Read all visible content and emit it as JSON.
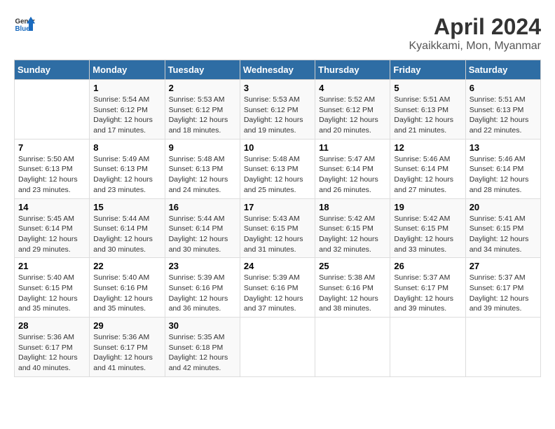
{
  "header": {
    "logo_line1": "General",
    "logo_line2": "Blue",
    "title": "April 2024",
    "subtitle": "Kyaikkami, Mon, Myanmar"
  },
  "days_of_week": [
    "Sunday",
    "Monday",
    "Tuesday",
    "Wednesday",
    "Thursday",
    "Friday",
    "Saturday"
  ],
  "weeks": [
    [
      {
        "day": "",
        "sunrise": "",
        "sunset": "",
        "daylight": ""
      },
      {
        "day": "1",
        "sunrise": "Sunrise: 5:54 AM",
        "sunset": "Sunset: 6:12 PM",
        "daylight": "Daylight: 12 hours and 17 minutes."
      },
      {
        "day": "2",
        "sunrise": "Sunrise: 5:53 AM",
        "sunset": "Sunset: 6:12 PM",
        "daylight": "Daylight: 12 hours and 18 minutes."
      },
      {
        "day": "3",
        "sunrise": "Sunrise: 5:53 AM",
        "sunset": "Sunset: 6:12 PM",
        "daylight": "Daylight: 12 hours and 19 minutes."
      },
      {
        "day": "4",
        "sunrise": "Sunrise: 5:52 AM",
        "sunset": "Sunset: 6:12 PM",
        "daylight": "Daylight: 12 hours and 20 minutes."
      },
      {
        "day": "5",
        "sunrise": "Sunrise: 5:51 AM",
        "sunset": "Sunset: 6:13 PM",
        "daylight": "Daylight: 12 hours and 21 minutes."
      },
      {
        "day": "6",
        "sunrise": "Sunrise: 5:51 AM",
        "sunset": "Sunset: 6:13 PM",
        "daylight": "Daylight: 12 hours and 22 minutes."
      }
    ],
    [
      {
        "day": "7",
        "sunrise": "Sunrise: 5:50 AM",
        "sunset": "Sunset: 6:13 PM",
        "daylight": "Daylight: 12 hours and 23 minutes."
      },
      {
        "day": "8",
        "sunrise": "Sunrise: 5:49 AM",
        "sunset": "Sunset: 6:13 PM",
        "daylight": "Daylight: 12 hours and 23 minutes."
      },
      {
        "day": "9",
        "sunrise": "Sunrise: 5:48 AM",
        "sunset": "Sunset: 6:13 PM",
        "daylight": "Daylight: 12 hours and 24 minutes."
      },
      {
        "day": "10",
        "sunrise": "Sunrise: 5:48 AM",
        "sunset": "Sunset: 6:13 PM",
        "daylight": "Daylight: 12 hours and 25 minutes."
      },
      {
        "day": "11",
        "sunrise": "Sunrise: 5:47 AM",
        "sunset": "Sunset: 6:14 PM",
        "daylight": "Daylight: 12 hours and 26 minutes."
      },
      {
        "day": "12",
        "sunrise": "Sunrise: 5:46 AM",
        "sunset": "Sunset: 6:14 PM",
        "daylight": "Daylight: 12 hours and 27 minutes."
      },
      {
        "day": "13",
        "sunrise": "Sunrise: 5:46 AM",
        "sunset": "Sunset: 6:14 PM",
        "daylight": "Daylight: 12 hours and 28 minutes."
      }
    ],
    [
      {
        "day": "14",
        "sunrise": "Sunrise: 5:45 AM",
        "sunset": "Sunset: 6:14 PM",
        "daylight": "Daylight: 12 hours and 29 minutes."
      },
      {
        "day": "15",
        "sunrise": "Sunrise: 5:44 AM",
        "sunset": "Sunset: 6:14 PM",
        "daylight": "Daylight: 12 hours and 30 minutes."
      },
      {
        "day": "16",
        "sunrise": "Sunrise: 5:44 AM",
        "sunset": "Sunset: 6:14 PM",
        "daylight": "Daylight: 12 hours and 30 minutes."
      },
      {
        "day": "17",
        "sunrise": "Sunrise: 5:43 AM",
        "sunset": "Sunset: 6:15 PM",
        "daylight": "Daylight: 12 hours and 31 minutes."
      },
      {
        "day": "18",
        "sunrise": "Sunrise: 5:42 AM",
        "sunset": "Sunset: 6:15 PM",
        "daylight": "Daylight: 12 hours and 32 minutes."
      },
      {
        "day": "19",
        "sunrise": "Sunrise: 5:42 AM",
        "sunset": "Sunset: 6:15 PM",
        "daylight": "Daylight: 12 hours and 33 minutes."
      },
      {
        "day": "20",
        "sunrise": "Sunrise: 5:41 AM",
        "sunset": "Sunset: 6:15 PM",
        "daylight": "Daylight: 12 hours and 34 minutes."
      }
    ],
    [
      {
        "day": "21",
        "sunrise": "Sunrise: 5:40 AM",
        "sunset": "Sunset: 6:15 PM",
        "daylight": "Daylight: 12 hours and 35 minutes."
      },
      {
        "day": "22",
        "sunrise": "Sunrise: 5:40 AM",
        "sunset": "Sunset: 6:16 PM",
        "daylight": "Daylight: 12 hours and 35 minutes."
      },
      {
        "day": "23",
        "sunrise": "Sunrise: 5:39 AM",
        "sunset": "Sunset: 6:16 PM",
        "daylight": "Daylight: 12 hours and 36 minutes."
      },
      {
        "day": "24",
        "sunrise": "Sunrise: 5:39 AM",
        "sunset": "Sunset: 6:16 PM",
        "daylight": "Daylight: 12 hours and 37 minutes."
      },
      {
        "day": "25",
        "sunrise": "Sunrise: 5:38 AM",
        "sunset": "Sunset: 6:16 PM",
        "daylight": "Daylight: 12 hours and 38 minutes."
      },
      {
        "day": "26",
        "sunrise": "Sunrise: 5:37 AM",
        "sunset": "Sunset: 6:17 PM",
        "daylight": "Daylight: 12 hours and 39 minutes."
      },
      {
        "day": "27",
        "sunrise": "Sunrise: 5:37 AM",
        "sunset": "Sunset: 6:17 PM",
        "daylight": "Daylight: 12 hours and 39 minutes."
      }
    ],
    [
      {
        "day": "28",
        "sunrise": "Sunrise: 5:36 AM",
        "sunset": "Sunset: 6:17 PM",
        "daylight": "Daylight: 12 hours and 40 minutes."
      },
      {
        "day": "29",
        "sunrise": "Sunrise: 5:36 AM",
        "sunset": "Sunset: 6:17 PM",
        "daylight": "Daylight: 12 hours and 41 minutes."
      },
      {
        "day": "30",
        "sunrise": "Sunrise: 5:35 AM",
        "sunset": "Sunset: 6:18 PM",
        "daylight": "Daylight: 12 hours and 42 minutes."
      },
      {
        "day": "",
        "sunrise": "",
        "sunset": "",
        "daylight": ""
      },
      {
        "day": "",
        "sunrise": "",
        "sunset": "",
        "daylight": ""
      },
      {
        "day": "",
        "sunrise": "",
        "sunset": "",
        "daylight": ""
      },
      {
        "day": "",
        "sunrise": "",
        "sunset": "",
        "daylight": ""
      }
    ]
  ]
}
